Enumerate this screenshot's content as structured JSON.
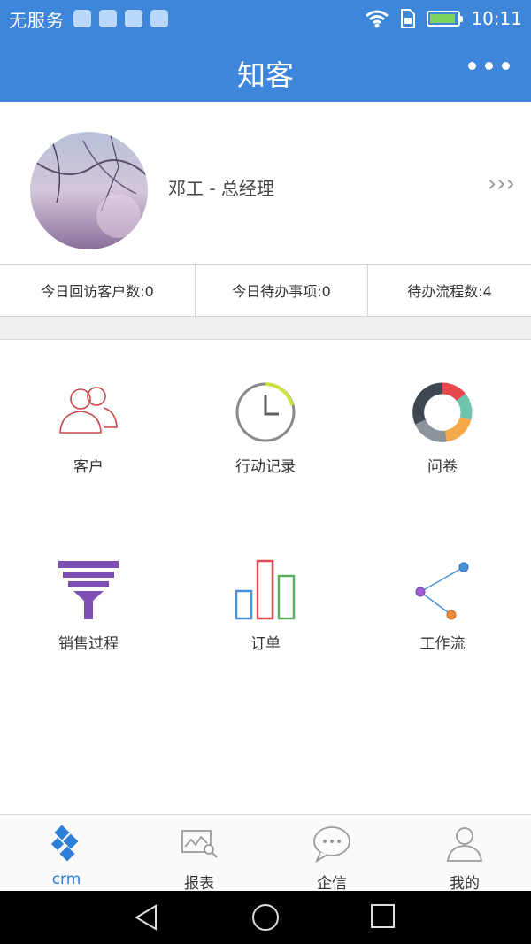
{
  "status_bar": {
    "carrier": "无服务",
    "time": "10:11",
    "icons": [
      "location-icon",
      "notification-icon",
      "mail-icon",
      "usb-icon",
      "wifi-icon",
      "sim-icon",
      "battery-icon"
    ]
  },
  "header": {
    "title": "知客"
  },
  "profile": {
    "name_title": "邓工  -  总经理",
    "chevron": "›››"
  },
  "stats": [
    {
      "label": "今日回访客户数:0"
    },
    {
      "label": "今日待办事项:0"
    },
    {
      "label": "待办流程数:4"
    }
  ],
  "grid": {
    "items": [
      {
        "label": "客户",
        "icon": "users-icon"
      },
      {
        "label": "行动记录",
        "icon": "clock-icon"
      },
      {
        "label": "问卷",
        "icon": "donut-chart-icon"
      },
      {
        "label": "销售过程",
        "icon": "funnel-icon"
      },
      {
        "label": "订单",
        "icon": "bar-chart-icon"
      },
      {
        "label": "工作流",
        "icon": "workflow-icon"
      }
    ]
  },
  "tabbar": {
    "active": "crm",
    "tabs": [
      {
        "label": "crm",
        "icon": "crm-icon"
      },
      {
        "label": "报表",
        "icon": "report-icon"
      },
      {
        "label": "企信",
        "icon": "chat-icon"
      },
      {
        "label": "我的",
        "icon": "profile-icon"
      }
    ]
  },
  "colors": {
    "primary": "#3d86d9",
    "active_tab": "#2f7fd8"
  }
}
